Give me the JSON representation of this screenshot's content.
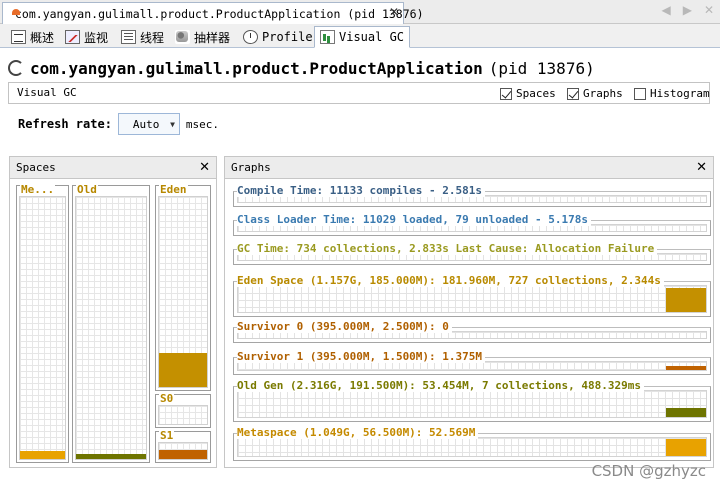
{
  "doc_tab": {
    "title": "com.yangyan.gulimall.product.ProductApplication (pid 13876)",
    "close_glyph": "✕"
  },
  "nav": {
    "back_glyph": "◀",
    "forward_glyph": "▶",
    "close_glyph": "✕"
  },
  "tools": [
    {
      "label": "概述",
      "icon": "overview-icon"
    },
    {
      "label": "监视",
      "icon": "monitor-icon"
    },
    {
      "label": "线程",
      "icon": "threads-icon"
    },
    {
      "label": "抽样器",
      "icon": "sampler-icon"
    },
    {
      "label": "Profiler",
      "icon": "profiler-icon"
    },
    {
      "label": "Visual GC",
      "icon": "visual-gc-icon",
      "active": true
    }
  ],
  "header": {
    "app_name": "com.yangyan.gulimall.product.ProductApplication",
    "pid": "(pid 13876)"
  },
  "vgc_bar": {
    "label": "Visual GC",
    "options": [
      {
        "label": "Spaces",
        "checked": true
      },
      {
        "label": "Graphs",
        "checked": true
      },
      {
        "label": "Histogram",
        "checked": false
      }
    ]
  },
  "refresh": {
    "label": "Refresh rate:",
    "value": "Auto",
    "unit": "msec."
  },
  "spaces_panel": {
    "title": "Spaces",
    "close_glyph": "✕",
    "columns": {
      "metaspace": {
        "label": "Me...",
        "fill_fraction": 0.03
      },
      "old": {
        "label": "Old",
        "fill_fraction": 0.02
      },
      "eden": {
        "label": "Eden",
        "fill_fraction": 0.18
      },
      "s0": {
        "label": "S0",
        "fill_fraction": 0.0
      },
      "s1": {
        "label": "S1",
        "fill_fraction": 0.55
      }
    }
  },
  "graphs_panel": {
    "title": "Graphs",
    "close_glyph": "✕",
    "rows": [
      {
        "label": "Compile Time: 11133 compiles - 2.581s",
        "color": "#3a5f85",
        "fill_fraction": 0
      },
      {
        "label": "Class Loader Time: 11029 loaded, 79 unloaded - 5.178s",
        "color": "#3a7ab0",
        "fill_fraction": 0
      },
      {
        "label": "GC Time: 734 collections, 2.833s  Last Cause: Allocation Failure",
        "color": "#9a9a20",
        "fill_fraction": 0
      },
      {
        "label": "Eden Space (1.157G, 185.000M): 181.960M, 727 collections, 2.344s",
        "color": "#b88a00",
        "fill_fraction": 0.92
      },
      {
        "label": "Survivor 0 (395.000M, 2.500M): 0",
        "color": "#b06000",
        "fill_fraction": 0
      },
      {
        "label": "Survivor 1 (395.000M, 1.500M): 1.375M",
        "color": "#b06000",
        "fill_fraction": 0.5
      },
      {
        "label": "Old Gen (2.316G, 191.500M): 53.454M, 7 collections, 488.329ms",
        "color": "#7a7a00",
        "fill_fraction": 0.35
      },
      {
        "label": "Metaspace (1.049G, 56.500M): 52.569M",
        "color": "#c48a00",
        "fill_fraction": 0.93
      }
    ]
  },
  "watermark": "CSDN @gzhyzc"
}
